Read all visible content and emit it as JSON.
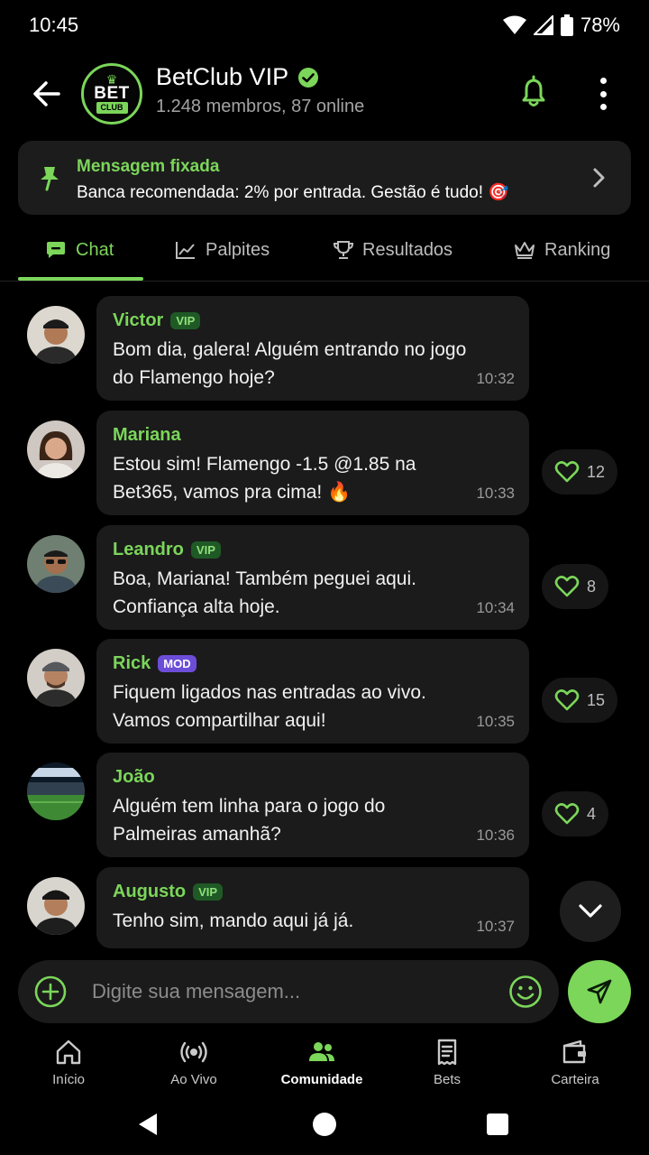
{
  "status": {
    "time": "10:45",
    "battery": "78%"
  },
  "header": {
    "logo_top": "BET",
    "logo_bottom": "CLUB",
    "title": "BetClub VIP",
    "subtitle": "1.248 membros, 87 online"
  },
  "pinned": {
    "title": "Mensagem fixada",
    "text": "Banca recomendada: 2% por entrada. Gestão é tudo! 🎯"
  },
  "tabs": [
    {
      "label": "Chat",
      "icon": "chat-icon",
      "active": true
    },
    {
      "label": "Palpites",
      "icon": "trend-chart-icon"
    },
    {
      "label": "Resultados",
      "icon": "trophy-icon"
    },
    {
      "label": "Ranking",
      "icon": "crown-icon"
    }
  ],
  "messages": [
    {
      "name": "Victor",
      "badge": "VIP",
      "text": "Bom dia, galera! Alguém entrando no jogo do Flamengo hoje?",
      "time": "10:32"
    },
    {
      "name": "Mariana",
      "badge": "",
      "text": "Estou sim! Flamengo -1.5 @1.85 na Bet365, vamos pra cima! 🔥",
      "time": "10:33",
      "likes": "12"
    },
    {
      "name": "Leandro",
      "badge": "VIP",
      "text": "Boa, Mariana! Também peguei aqui. Confiança alta hoje.",
      "time": "10:34",
      "likes": "8"
    },
    {
      "name": "Rick",
      "badge": "MOD",
      "text": "Fiquem ligados nas entradas ao vivo. Vamos compartilhar aqui!",
      "time": "10:35",
      "likes": "15"
    },
    {
      "name": "João",
      "badge": "",
      "text": "Alguém tem linha para o jogo do Palmeiras amanhã?",
      "time": "10:36",
      "likes": "4"
    },
    {
      "name": "Augusto",
      "badge": "VIP",
      "text": "Tenho sim, mando aqui já já.",
      "time": "10:37"
    }
  ],
  "composer": {
    "placeholder": "Digite sua mensagem..."
  },
  "bottom_nav": [
    {
      "label": "Início",
      "icon": "home-icon"
    },
    {
      "label": "Ao Vivo",
      "icon": "live-broadcast-icon"
    },
    {
      "label": "Comunidade",
      "icon": "community-icon",
      "active": true
    },
    {
      "label": "Bets",
      "icon": "receipt-icon"
    },
    {
      "label": "Carteira",
      "icon": "wallet-icon"
    }
  ],
  "colors": {
    "accent": "#7bd65a",
    "background": "#000000",
    "bubble": "#1b1b1b",
    "mod_badge": "#6c4dd8"
  }
}
